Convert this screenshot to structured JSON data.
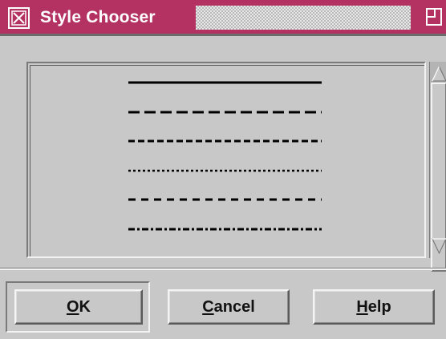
{
  "window": {
    "title": "Style Chooser",
    "menu_icon": "window-menu-icon",
    "maximize_icon": "maximize-icon"
  },
  "line_styles": [
    {
      "name": "solid",
      "dasharray": "none"
    },
    {
      "name": "long-dash",
      "dasharray": "14 6"
    },
    {
      "name": "medium-dash",
      "dasharray": "8 4"
    },
    {
      "name": "dotted",
      "dasharray": "3 3"
    },
    {
      "name": "short-dash",
      "dasharray": "9 7"
    },
    {
      "name": "dash-dot",
      "dasharray": "8 3 3 3"
    }
  ],
  "buttons": {
    "ok": {
      "mnemonic": "O",
      "rest": "K"
    },
    "cancel": {
      "mnemonic": "C",
      "rest": "ancel"
    },
    "help": {
      "mnemonic": "H",
      "rest": "elp"
    }
  },
  "colors": {
    "titlebar": "#b33262",
    "background": "#c8c8c8",
    "line": "#000000"
  }
}
